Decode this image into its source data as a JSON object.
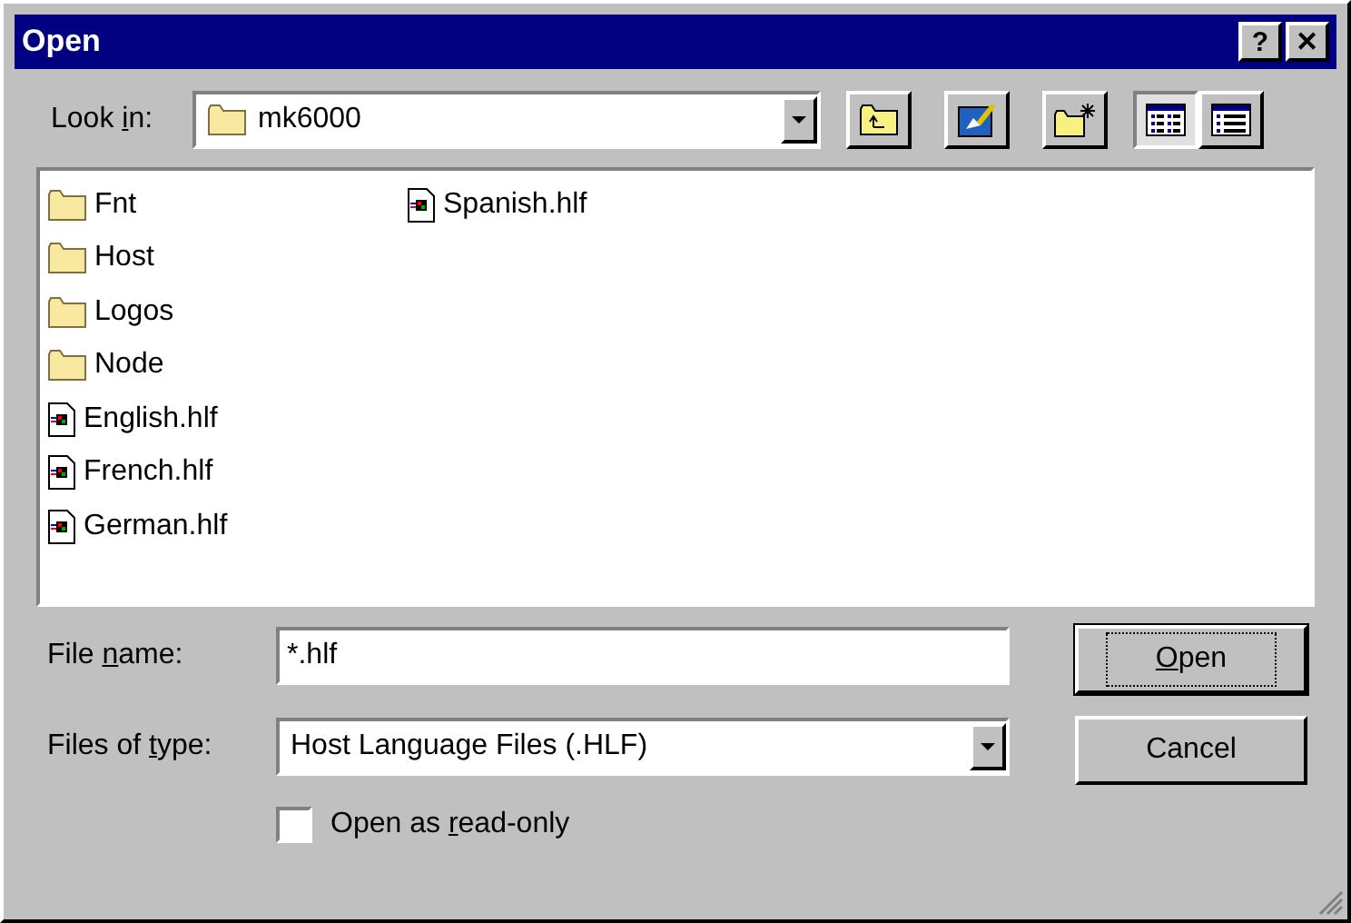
{
  "window": {
    "title": "Open",
    "title_buttons": [
      "?",
      "✕"
    ]
  },
  "look_in": {
    "label": [
      "Look ",
      "i",
      "n:"
    ],
    "value": "mk6000"
  },
  "view_buttons": [
    {
      "kind": "list",
      "selected": true
    },
    {
      "kind": "details",
      "selected": false
    }
  ],
  "files": [
    {
      "name": "Fnt",
      "kind": "folder"
    },
    {
      "name": "Host",
      "kind": "folder"
    },
    {
      "name": "Logos",
      "kind": "folder"
    },
    {
      "name": "Node",
      "kind": "folder"
    },
    {
      "name": "English.hlf",
      "kind": "file"
    },
    {
      "name": "French.hlf",
      "kind": "file"
    },
    {
      "name": "German.hlf",
      "kind": "file"
    },
    {
      "name": "Spanish.hlf",
      "kind": "file"
    }
  ],
  "file_name": {
    "label": [
      "File ",
      "n",
      "ame:"
    ],
    "value": "*.hlf"
  },
  "files_of_type": {
    "label": [
      "Files of ",
      "t",
      "ype:"
    ],
    "value": "Host Language Files (.HLF)"
  },
  "read_only": {
    "label": [
      "Open as ",
      "r",
      "ead-only"
    ],
    "checked": false
  },
  "buttons": [
    {
      "label": {
        "key": "O",
        "after": "pen"
      },
      "default": true
    },
    {
      "label": {
        "before": "Cancel"
      },
      "default": false
    }
  ]
}
